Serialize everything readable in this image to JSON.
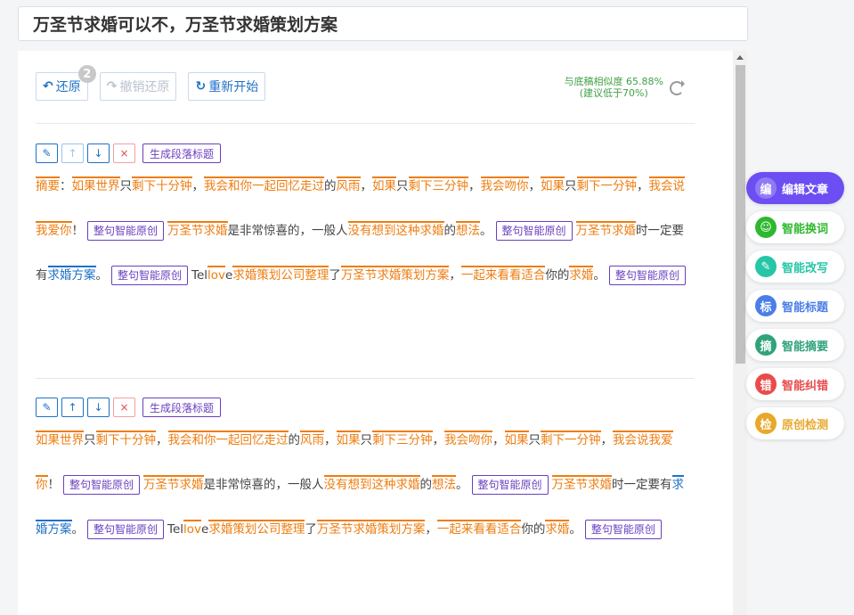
{
  "title": "万圣节求婚可以不，万圣节求婚策划方案",
  "toolbar": {
    "undo_label": "还原",
    "undo_badge": "2",
    "redo_label": "撤销还原",
    "restart_label": "重新开始"
  },
  "similarity": {
    "line1": "与底稿相似度 65.88%",
    "line2": "(建议低于70%)"
  },
  "paragraph_tools": {
    "edit_icon": "pencil-icon",
    "up_icon": "arrow-up-icon",
    "down_icon": "arrow-down-icon",
    "delete_icon": "close-icon",
    "generate_label": "生成段落标题"
  },
  "paragraphs": [
    {
      "segments": [
        {
          "t": "摘要",
          "s": "o"
        },
        {
          "t": "：",
          "s": ""
        },
        {
          "t": "如果",
          "s": "o"
        },
        {
          "t": "世界",
          "s": "o"
        },
        {
          "t": "只",
          "s": ""
        },
        {
          "t": "剩下",
          "s": "o"
        },
        {
          "t": "十分钟",
          "s": "o"
        },
        {
          "t": "，",
          "s": ""
        },
        {
          "t": "我会",
          "s": "o"
        },
        {
          "t": "和你一起",
          "s": "o"
        },
        {
          "t": "回忆",
          "s": "o"
        },
        {
          "t": "走过",
          "s": "o"
        },
        {
          "t": "的",
          "s": ""
        },
        {
          "t": "风雨",
          "s": "o"
        },
        {
          "t": "，",
          "s": ""
        },
        {
          "t": "如果",
          "s": "o"
        },
        {
          "t": "只",
          "s": ""
        },
        {
          "t": "剩下",
          "s": "o"
        },
        {
          "t": "三分钟",
          "s": "o"
        },
        {
          "t": "，",
          "s": ""
        },
        {
          "t": "我会",
          "s": "o"
        },
        {
          "t": "吻你",
          "s": "o"
        },
        {
          "t": "，",
          "s": ""
        },
        {
          "t": "如果",
          "s": "o"
        },
        {
          "t": "只",
          "s": ""
        },
        {
          "t": "剩下",
          "s": "o"
        },
        {
          "t": "一分钟",
          "s": "o"
        },
        {
          "t": "，",
          "s": ""
        },
        {
          "t": "我会",
          "s": "o"
        },
        {
          "t": "说我爱你",
          "s": "o"
        },
        {
          "t": "！",
          "s": ""
        },
        {
          "t": "整句智能原创",
          "s": "tag"
        },
        {
          "t": "万圣节",
          "s": "o"
        },
        {
          "t": "求婚",
          "s": "o"
        },
        {
          "t": "是非常惊喜的，一般人",
          "s": ""
        },
        {
          "t": "没有",
          "s": "o"
        },
        {
          "t": "想到",
          "s": "o"
        },
        {
          "t": "这种",
          "s": "o"
        },
        {
          "t": "求婚",
          "s": "o"
        },
        {
          "t": "的",
          "s": ""
        },
        {
          "t": "想法",
          "s": "o"
        },
        {
          "t": "。",
          "s": ""
        },
        {
          "t": "整句智能原创",
          "s": "tag"
        },
        {
          "t": "万圣节",
          "s": "o"
        },
        {
          "t": "求婚",
          "s": "o"
        },
        {
          "t": "时一定要有",
          "s": ""
        },
        {
          "t": "求婚方案",
          "s": "b"
        },
        {
          "t": "。",
          "s": ""
        },
        {
          "t": "整句智能原创",
          "s": "tag"
        },
        {
          "t": "Tel",
          "s": ""
        },
        {
          "t": "lov",
          "s": "o"
        },
        {
          "t": "e",
          "s": ""
        },
        {
          "t": "求婚策划",
          "s": "o"
        },
        {
          "t": "公司",
          "s": "o"
        },
        {
          "t": "整理",
          "s": "o"
        },
        {
          "t": "了",
          "s": ""
        },
        {
          "t": "万圣节",
          "s": "o"
        },
        {
          "t": "求婚策划",
          "s": "o"
        },
        {
          "t": "方案",
          "s": "o"
        },
        {
          "t": "，",
          "s": ""
        },
        {
          "t": "一起来",
          "s": "o"
        },
        {
          "t": "看看",
          "s": "o"
        },
        {
          "t": "适合",
          "s": "o"
        },
        {
          "t": "你的",
          "s": ""
        },
        {
          "t": "求婚",
          "s": "o"
        },
        {
          "t": "。",
          "s": ""
        },
        {
          "t": "整句智能原创",
          "s": "tag"
        }
      ]
    },
    {
      "segments": [
        {
          "t": "如果",
          "s": "o"
        },
        {
          "t": "世界",
          "s": "o"
        },
        {
          "t": "只",
          "s": ""
        },
        {
          "t": "剩下",
          "s": "o"
        },
        {
          "t": "十分钟",
          "s": "o"
        },
        {
          "t": "，",
          "s": ""
        },
        {
          "t": "我会",
          "s": "o"
        },
        {
          "t": "和你一起",
          "s": "o"
        },
        {
          "t": "回忆",
          "s": "o"
        },
        {
          "t": "走过",
          "s": "o"
        },
        {
          "t": "的",
          "s": ""
        },
        {
          "t": "风雨",
          "s": "o"
        },
        {
          "t": "，",
          "s": ""
        },
        {
          "t": "如果",
          "s": "o"
        },
        {
          "t": "只",
          "s": ""
        },
        {
          "t": "剩下",
          "s": "o"
        },
        {
          "t": "三分钟",
          "s": "o"
        },
        {
          "t": "，",
          "s": ""
        },
        {
          "t": "我会",
          "s": "o"
        },
        {
          "t": "吻你",
          "s": "o"
        },
        {
          "t": "，",
          "s": ""
        },
        {
          "t": "如果",
          "s": "o"
        },
        {
          "t": "只",
          "s": ""
        },
        {
          "t": "剩下",
          "s": "o"
        },
        {
          "t": "一分钟",
          "s": "o"
        },
        {
          "t": "，",
          "s": ""
        },
        {
          "t": "我会",
          "s": "o"
        },
        {
          "t": "说我爱你",
          "s": "o"
        },
        {
          "t": "！",
          "s": ""
        },
        {
          "t": "整句智能原创",
          "s": "tag"
        },
        {
          "t": "万圣节",
          "s": "o"
        },
        {
          "t": "求婚",
          "s": "o"
        },
        {
          "t": "是非常惊喜的，一般人",
          "s": ""
        },
        {
          "t": "没有",
          "s": "o"
        },
        {
          "t": "想到",
          "s": "o"
        },
        {
          "t": "这种",
          "s": "o"
        },
        {
          "t": "求婚",
          "s": "o"
        },
        {
          "t": "的",
          "s": ""
        },
        {
          "t": "想法",
          "s": "o"
        },
        {
          "t": "。",
          "s": ""
        },
        {
          "t": "整句智能原创",
          "s": "tag"
        },
        {
          "t": "万圣节",
          "s": "o"
        },
        {
          "t": "求婚",
          "s": "o"
        },
        {
          "t": "时一定要有",
          "s": ""
        },
        {
          "t": "求婚方案",
          "s": "b"
        },
        {
          "t": "。",
          "s": ""
        },
        {
          "t": "整句智能原创",
          "s": "tag"
        },
        {
          "t": "Tel",
          "s": ""
        },
        {
          "t": "lov",
          "s": "o"
        },
        {
          "t": "e",
          "s": ""
        },
        {
          "t": "求婚策划",
          "s": "o"
        },
        {
          "t": "公司",
          "s": "o"
        },
        {
          "t": "整理",
          "s": "o"
        },
        {
          "t": "了",
          "s": ""
        },
        {
          "t": "万圣节",
          "s": "o"
        },
        {
          "t": "求婚策划",
          "s": "o"
        },
        {
          "t": "方案",
          "s": "o"
        },
        {
          "t": "，",
          "s": ""
        },
        {
          "t": "一起来",
          "s": "o"
        },
        {
          "t": "看看",
          "s": "o"
        },
        {
          "t": "适合",
          "s": "o"
        },
        {
          "t": "你的",
          "s": ""
        },
        {
          "t": "求婚",
          "s": "o"
        },
        {
          "t": "。",
          "s": ""
        },
        {
          "t": "整句智能原创",
          "s": "tag"
        }
      ]
    }
  ],
  "sidebar": {
    "items": [
      {
        "label": "编辑文章",
        "icon_char": "编",
        "icon": "edit-article-icon",
        "color": "#6c4ef2",
        "active": true
      },
      {
        "label": "智能换词",
        "icon_char": "☺",
        "icon": "robot-icon",
        "color": "#2eb82e",
        "active": false
      },
      {
        "label": "智能改写",
        "icon_char": "✎",
        "icon": "rewrite-icon",
        "color": "#26c6a6",
        "active": false
      },
      {
        "label": "智能标题",
        "icon_char": "标",
        "icon": "title-icon",
        "color": "#4a7ee8",
        "active": false
      },
      {
        "label": "智能摘要",
        "icon_char": "摘",
        "icon": "summary-icon",
        "color": "#2fa37a",
        "active": false
      },
      {
        "label": "智能纠错",
        "icon_char": "错",
        "icon": "error-check-icon",
        "color": "#e94b4b",
        "active": false
      },
      {
        "label": "原创检测",
        "icon_char": "检",
        "icon": "originality-icon",
        "color": "#e8a82a",
        "active": false
      }
    ]
  }
}
